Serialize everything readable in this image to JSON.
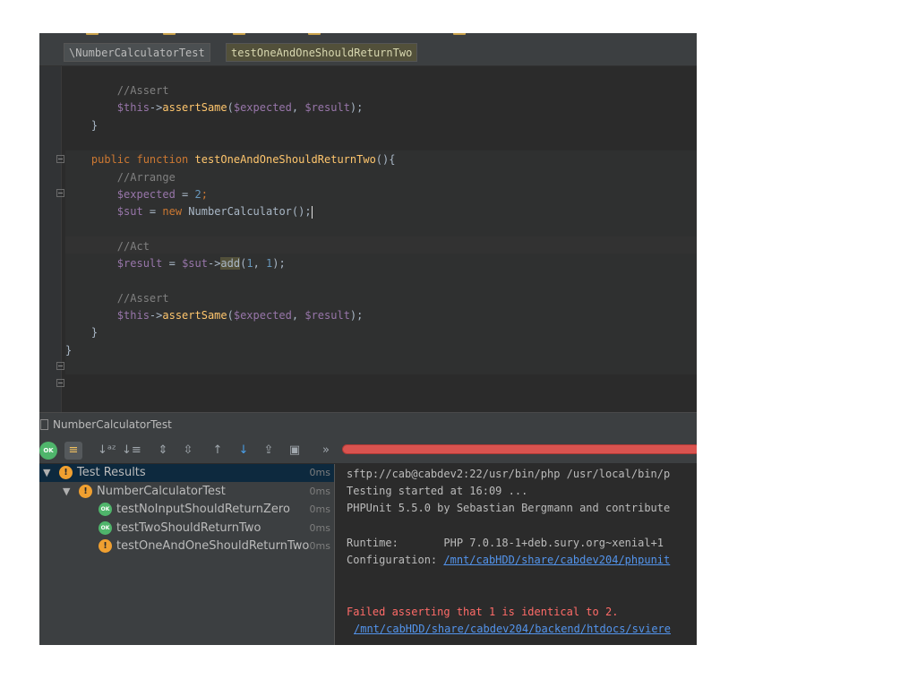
{
  "breadcrumbs": [
    "\\NumberCalculatorTest",
    "testOneAndOneShouldReturnTwo"
  ],
  "code": [
    [
      {
        "t": "        "
      },
      {
        "t": "//Assert",
        "c": "cm"
      }
    ],
    [
      {
        "t": "        "
      },
      {
        "t": "$this",
        "c": "var"
      },
      {
        "t": "->"
      },
      {
        "t": "assertSame",
        "c": "fn"
      },
      {
        "t": "("
      },
      {
        "t": "$expected",
        "c": "var"
      },
      {
        "t": ", "
      },
      {
        "t": "$result",
        "c": "var"
      },
      {
        "t": ");"
      }
    ],
    [
      {
        "t": "    }"
      }
    ],
    [
      {
        "t": ""
      }
    ],
    [
      {
        "t": "    "
      },
      {
        "t": "public function ",
        "c": "kw"
      },
      {
        "t": "testOneAndOneShouldReturnTwo",
        "c": "fn"
      },
      {
        "t": "(){"
      }
    ],
    [
      {
        "t": "        "
      },
      {
        "t": "//Arrange",
        "c": "cm"
      }
    ],
    [
      {
        "t": "        "
      },
      {
        "t": "$expected",
        "c": "var"
      },
      {
        "t": " = "
      },
      {
        "t": "2",
        "c": "num"
      },
      {
        "t": ";",
        "c": "kw"
      }
    ],
    [
      {
        "t": "        "
      },
      {
        "t": "$sut",
        "c": "var"
      },
      {
        "t": " = "
      },
      {
        "t": "new ",
        "c": "kw"
      },
      {
        "t": "NumberCalculator"
      },
      {
        "t": "();"
      },
      {
        "caret": true
      }
    ],
    [
      {
        "t": ""
      }
    ],
    [
      {
        "t": "        "
      },
      {
        "t": "//Act",
        "c": "cm"
      }
    ],
    [
      {
        "t": "        "
      },
      {
        "t": "$result",
        "c": "var"
      },
      {
        "t": " = "
      },
      {
        "t": "$sut",
        "c": "var"
      },
      {
        "t": "->"
      },
      {
        "t": "add",
        "c": "hl"
      },
      {
        "t": "("
      },
      {
        "t": "1",
        "c": "num"
      },
      {
        "t": ", "
      },
      {
        "t": "1",
        "c": "num"
      },
      {
        "t": ");"
      }
    ],
    [
      {
        "t": ""
      }
    ],
    [
      {
        "t": "        "
      },
      {
        "t": "//Assert",
        "c": "cm"
      }
    ],
    [
      {
        "t": "        "
      },
      {
        "t": "$this",
        "c": "var"
      },
      {
        "t": "->"
      },
      {
        "t": "assertSame",
        "c": "fn"
      },
      {
        "t": "("
      },
      {
        "t": "$expected",
        "c": "var"
      },
      {
        "t": ", "
      },
      {
        "t": "$result",
        "c": "var"
      },
      {
        "t": ");"
      }
    ],
    [
      {
        "t": "    }"
      }
    ],
    [
      {
        "t": "}"
      }
    ]
  ],
  "run_panel": {
    "title": "NumberCalculatorTest"
  },
  "toolbar_icons": [
    {
      "name": "show-passed-icon",
      "glyph": "OK",
      "on": false
    },
    {
      "name": "show-ignored-icon",
      "glyph": "≡",
      "on": true
    },
    {
      "name": "sort-alphabetically-icon",
      "glyph": "↓ᵃᶻ",
      "on": false
    },
    {
      "name": "sort-by-duration-icon",
      "glyph": "↓≡",
      "on": false
    },
    {
      "name": "expand-all-icon",
      "glyph": "⇕",
      "on": false
    },
    {
      "name": "collapse-all-icon",
      "glyph": "⇳",
      "on": false
    },
    {
      "name": "previous-failed-test-icon",
      "glyph": "↑",
      "on": false
    },
    {
      "name": "next-failed-test-icon",
      "glyph": "↓",
      "on": false
    },
    {
      "name": "export-results-icon",
      "glyph": "⇪",
      "on": false
    },
    {
      "name": "import-results-icon",
      "glyph": "▣",
      "on": false
    },
    {
      "name": "more-actions-icon",
      "glyph": "»",
      "on": false
    }
  ],
  "test_tree": [
    {
      "label": "Test Results",
      "time": "0ms",
      "status": "fail",
      "level": 0,
      "expanded": true,
      "selected": true
    },
    {
      "label": "NumberCalculatorTest",
      "time": "0ms",
      "status": "fail",
      "level": 1,
      "expanded": true,
      "selected": false
    },
    {
      "label": "testNoInputShouldReturnZero",
      "time": "0ms",
      "status": "ok",
      "level": 2,
      "selected": false
    },
    {
      "label": "testTwoShouldReturnTwo",
      "time": "0ms",
      "status": "ok",
      "level": 2,
      "selected": false
    },
    {
      "label": "testOneAndOneShouldReturnTwo",
      "time": "0ms",
      "status": "fail",
      "level": 2,
      "selected": false
    }
  ],
  "console": {
    "command": "sftp://cab@cabdev2:22/usr/bin/php /usr/local/bin/p",
    "started": "Testing started at 16:09 ...",
    "phpunit": "PHPUnit 5.5.0 by Sebastian Bergmann and contribute",
    "runtime_label": "Runtime:       ",
    "runtime_value": "PHP 7.0.18-1+deb.sury.org~xenial+1",
    "config_label": "Configuration: ",
    "config_link": "/mnt/cabHDD/share/cabdev204/phpunit",
    "error": "Failed asserting that 1 is identical to 2.",
    "trace_link": "/mnt/cabHDD/share/cabdev204/backend/htdocs/sviere"
  },
  "colors": {
    "progress_fail": "#d9534f",
    "status_fail": "#f0a030",
    "status_ok": "#4fb56b"
  }
}
